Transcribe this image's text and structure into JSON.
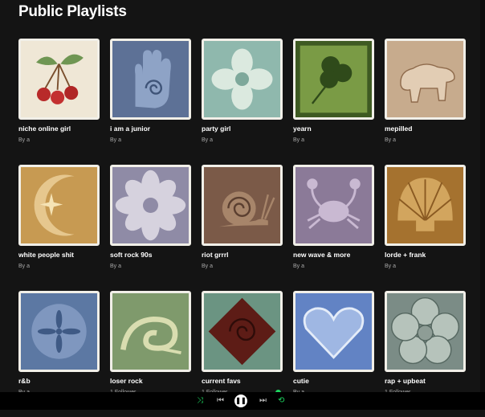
{
  "page": {
    "title": "Public Playlists"
  },
  "playlists": [
    {
      "name": "niche online girl",
      "subtitle": "By a",
      "cover_icon": "cherries-tile-icon",
      "cover_color": "#efe7d6"
    },
    {
      "name": "i am a junior",
      "subtitle": "By a",
      "cover_icon": "hand-spiral-tile-icon",
      "cover_color": "#5d7196"
    },
    {
      "name": "party girl",
      "subtitle": "By a",
      "cover_icon": "flower-tile-icon",
      "cover_color": "#8fb8ad"
    },
    {
      "name": "yearn",
      "subtitle": "By a",
      "cover_icon": "clover-tile-icon",
      "cover_color": "#6b8d3c"
    },
    {
      "name": "mepilled",
      "subtitle": "By a",
      "cover_icon": "bear-tile-icon",
      "cover_color": "#c7ab8d"
    },
    {
      "name": "white people shit",
      "subtitle": "By a",
      "cover_icon": "moon-star-tile-icon",
      "cover_color": "#c79a52"
    },
    {
      "name": "soft rock 90s",
      "subtitle": "By a",
      "cover_icon": "daisy-tile-icon",
      "cover_color": "#8f8ba6"
    },
    {
      "name": "riot grrrl",
      "subtitle": "By a",
      "cover_icon": "snail-tile-icon",
      "cover_color": "#7b5a48"
    },
    {
      "name": "new wave & more",
      "subtitle": "By a",
      "cover_icon": "crab-tile-icon",
      "cover_color": "#8b7a98"
    },
    {
      "name": "lorde + frank",
      "subtitle": "By a",
      "cover_icon": "shell-tile-icon",
      "cover_color": "#a5722f"
    },
    {
      "name": "r&b",
      "subtitle": "By a",
      "cover_icon": "sand-dollar-tile-icon",
      "cover_color": "#5c78a3"
    },
    {
      "name": "loser rock",
      "subtitle": "1 Follower",
      "cover_icon": "fox-tile-icon",
      "cover_color": "#7f9a6c"
    },
    {
      "name": "current favs",
      "subtitle": "1 Follower",
      "cover_icon": "rose-tile-icon",
      "cover_color": "#5d1c16"
    },
    {
      "name": "cutie",
      "subtitle": "By a",
      "cover_icon": "heart-tile-icon",
      "cover_color": "#6283c4"
    },
    {
      "name": "rap + upbeat",
      "subtitle": "1 Follower",
      "cover_icon": "wild-rose-tile-icon",
      "cover_color": "#7b8c86"
    }
  ],
  "player": {
    "shuffle_icon": "shuffle-icon",
    "previous_icon": "previous-icon",
    "pause_icon": "pause-icon",
    "next_icon": "next-icon",
    "repeat_icon": "repeat-icon",
    "accent_color": "#1ed760"
  }
}
